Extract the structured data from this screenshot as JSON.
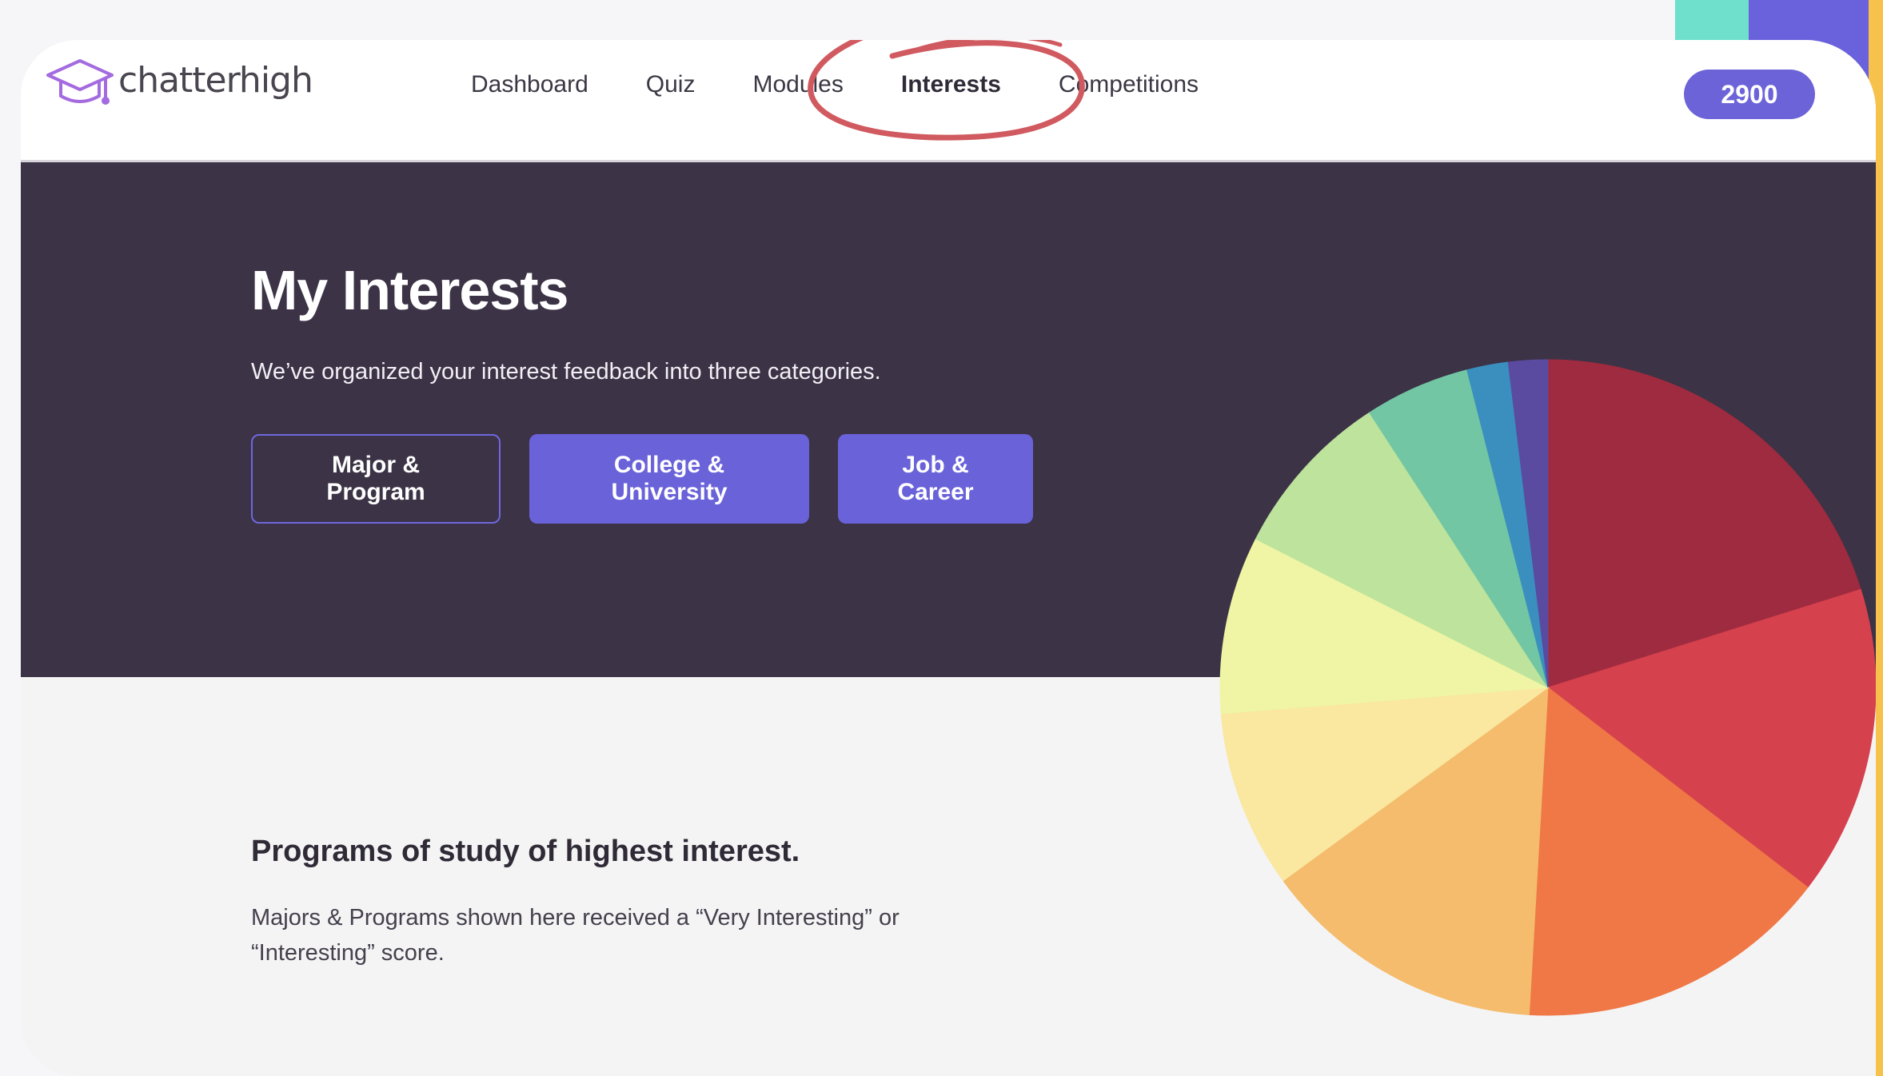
{
  "app": {
    "logo_text": "chatterhigh"
  },
  "nav": {
    "items": [
      {
        "label": "Dashboard"
      },
      {
        "label": "Quiz"
      },
      {
        "label": "Modules"
      },
      {
        "label": "Interests",
        "active": true
      },
      {
        "label": "Competitions"
      }
    ]
  },
  "points": {
    "value": "2900"
  },
  "hero": {
    "title": "My Interests",
    "subtitle": "We’ve organized your interest feedback into three categories.",
    "tabs": [
      {
        "label": "Major & Program",
        "selected": true
      },
      {
        "label": "College & University"
      },
      {
        "label": "Job & Career"
      }
    ]
  },
  "section": {
    "title": "Programs of study of highest interest.",
    "description": "Majors & Programs shown here received a “Very Interesting” or “Interesting” score."
  },
  "colors": {
    "accent": "#6a62d9",
    "hero_background": "#3c3346",
    "annotation": "#d05a5f"
  },
  "chart_data": {
    "type": "pie",
    "values": [
      19.8,
      15.0,
      15.2,
      13.8,
      8.6,
      8.6,
      8.2,
      5.1,
      2.0,
      1.9
    ],
    "colors": [
      "#9e2b3f",
      "#d5414d",
      "#ef7846",
      "#f4bc6c",
      "#fae7a0",
      "#eff5a4",
      "#bde39c",
      "#72c6a3",
      "#3a8fbf",
      "#5b4ba0"
    ]
  }
}
